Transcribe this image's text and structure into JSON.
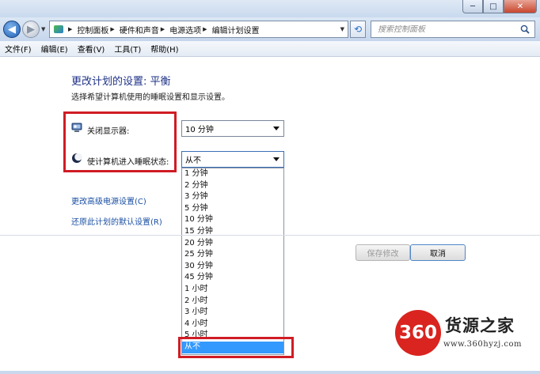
{
  "window": {
    "buttons": {
      "minimize": "─",
      "maximize": "□",
      "close": "✕"
    }
  },
  "nav": {
    "back_icon": "back-arrow-icon",
    "forward_icon": "forward-arrow-icon",
    "breadcrumb": [
      "控制面板",
      "硬件和声音",
      "电源选项",
      "编辑计划设置"
    ],
    "search_placeholder": "搜索控制面板"
  },
  "menu": [
    "文件(F)",
    "编辑(E)",
    "查看(V)",
    "工具(T)",
    "帮助(H)"
  ],
  "content": {
    "title": "更改计划的设置: 平衡",
    "subtitle": "选择希望计算机使用的睡眠设置和显示设置。",
    "display_label": "关闭显示器:",
    "display_value": "10 分钟",
    "sleep_label": "使计算机进入睡眠状态:",
    "sleep_value": "从不",
    "sleep_options": [
      "1 分钟",
      "2 分钟",
      "3 分钟",
      "5 分钟",
      "10 分钟",
      "15 分钟",
      "20 分钟",
      "25 分钟",
      "30 分钟",
      "45 分钟",
      "1 小时",
      "2 小时",
      "3 小时",
      "4 小时",
      "5 小时",
      "从不"
    ],
    "selected_option_index": 15,
    "link_advanced": "更改高级电源设置(C)",
    "link_restore": "还原此计划的默认设置(R)",
    "save_button": "保存修改",
    "cancel_button": "取消"
  },
  "watermark": {
    "badge": "360",
    "title": "货源之家",
    "url": "www.360hyzj.com"
  },
  "colors": {
    "title_blue": "#1e3287",
    "link_blue": "#1a4fa3",
    "highlight_red": "#d01c24",
    "selection_blue": "#3399ff"
  }
}
